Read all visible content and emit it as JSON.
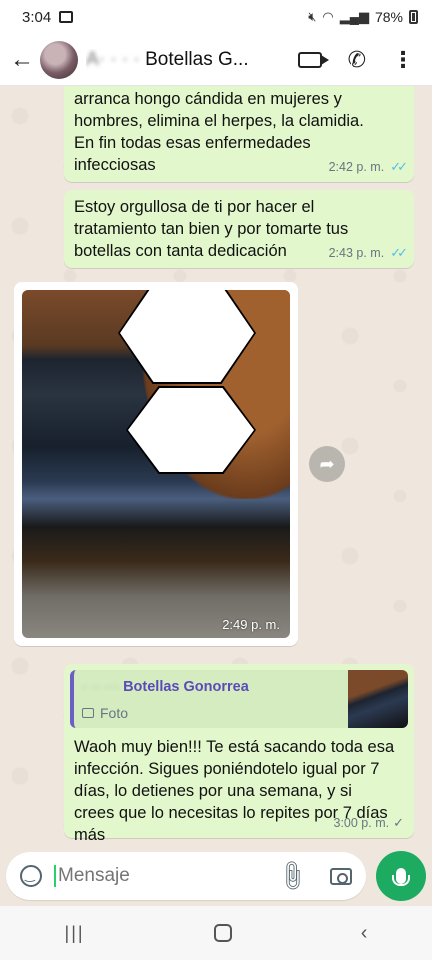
{
  "status_bar": {
    "time": "3:04",
    "battery": "78%"
  },
  "header": {
    "contact_name_hidden": "A· · · ·",
    "contact_name_visible": "Botellas G..."
  },
  "messages": [
    {
      "text": "arranca hongo cándida en mujeres y hombres, elimina el herpes, la clamidia. En fin todas esas enfermedades infecciosas",
      "time": "2:42 p. m."
    },
    {
      "text": "Estoy orgullosa de ti por hacer el tratamiento tan bien y por tomarte tus botellas con tanta dedicación",
      "time": "2:43 p. m."
    },
    {
      "time": "2:49 p. m."
    },
    {
      "quote_author_hidden": "· ·· ···",
      "quote_author": "Botellas Gonorrea",
      "quote_type": "Foto",
      "text": "Waoh muy bien!!! Te está sacando toda esa infección. Sigues poniéndotelo igual por 7 días, lo detienes por una semana, y si crees que lo necesitas lo repites por 7 días más",
      "time": "3:00 p. m."
    }
  ],
  "input": {
    "placeholder": "Mensaje"
  },
  "colors": {
    "outgoing_bubble": "#e2f7cb",
    "read_ticks": "#53bdeb",
    "accent_green": "#1daa61"
  }
}
